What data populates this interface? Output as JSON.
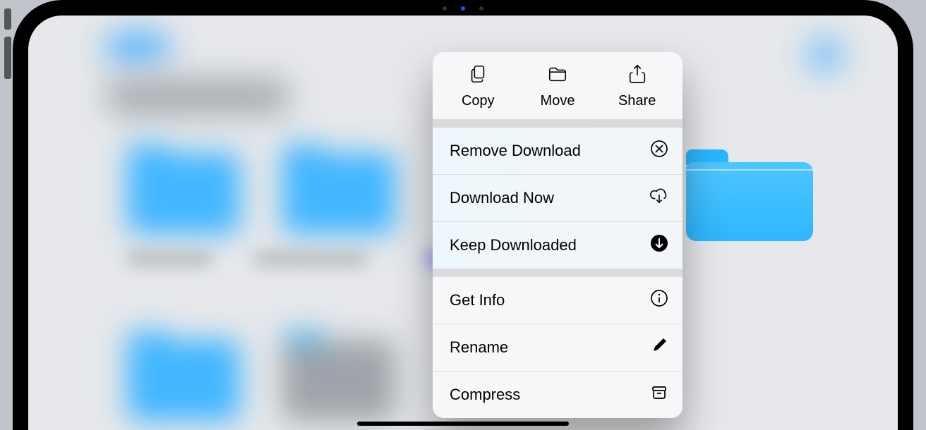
{
  "menu": {
    "top": {
      "copy": "Copy",
      "move": "Move",
      "share": "Share"
    },
    "group1": {
      "remove_download": "Remove Download",
      "download_now": "Download Now",
      "keep_downloaded": "Keep Downloaded"
    },
    "group2": {
      "get_info": "Get Info",
      "rename": "Rename",
      "compress": "Compress"
    }
  }
}
